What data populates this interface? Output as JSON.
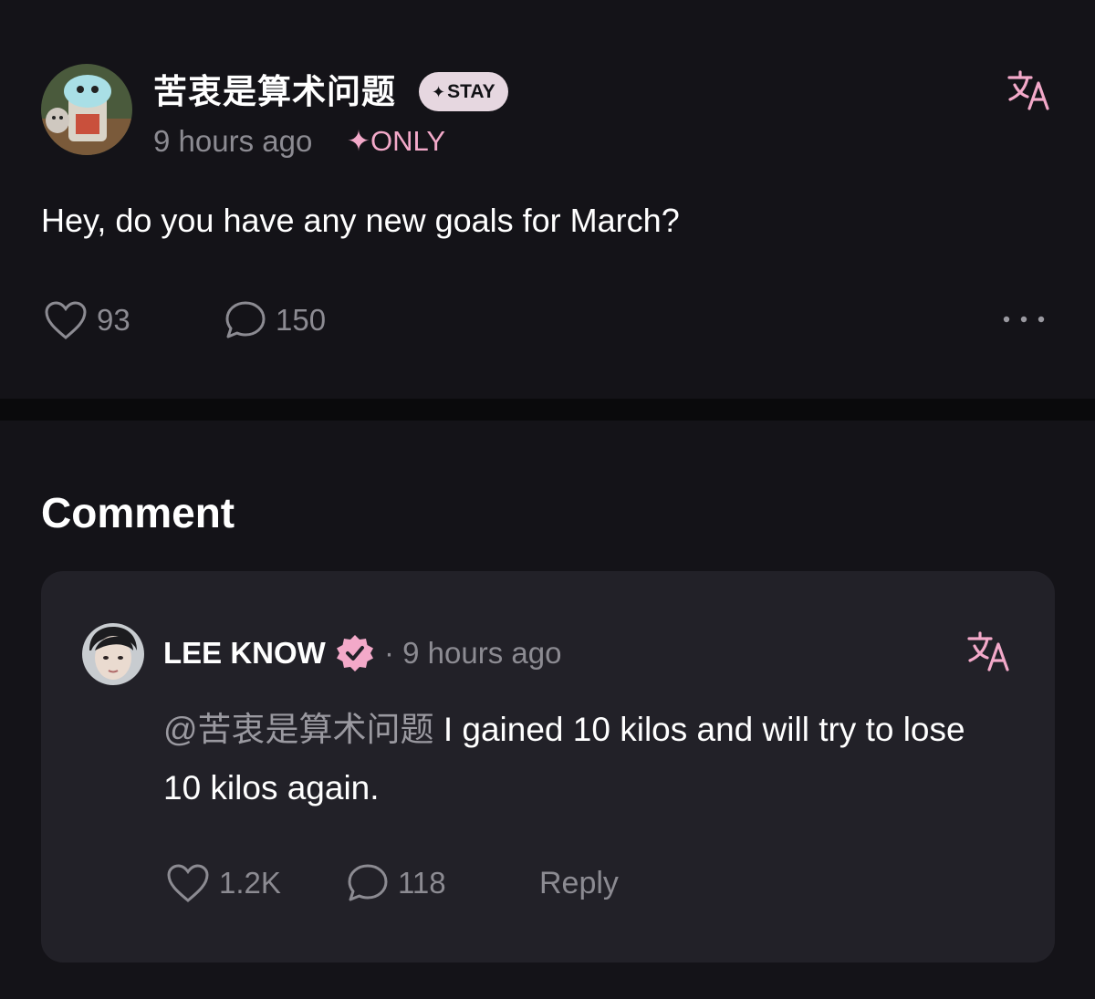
{
  "post": {
    "username": "苦衷是算术问题",
    "badge": "STAY",
    "time": "9 hours ago",
    "only_tag": "ONLY",
    "text": "Hey, do you have any new goals for March?",
    "likes": "93",
    "comments": "150"
  },
  "comments_section": {
    "title": "Comment"
  },
  "comment": {
    "author": "LEE KNOW",
    "time": "· 9 hours ago",
    "mention": "@苦衷是算术问题",
    "text": " I gained 10 kilos and will try to lose 10 kilos again.",
    "likes": "1.2K",
    "replies": "118",
    "reply_label": "Reply"
  },
  "colors": {
    "background": "#141318",
    "card": "#222128",
    "accent_pink": "#f3a9c9",
    "muted_text": "#8c8b92"
  },
  "icons": [
    "translate-icon",
    "heart-icon",
    "comment-bubble-icon",
    "more-dots-icon",
    "verified-badge-icon",
    "sparkle-icon"
  ]
}
